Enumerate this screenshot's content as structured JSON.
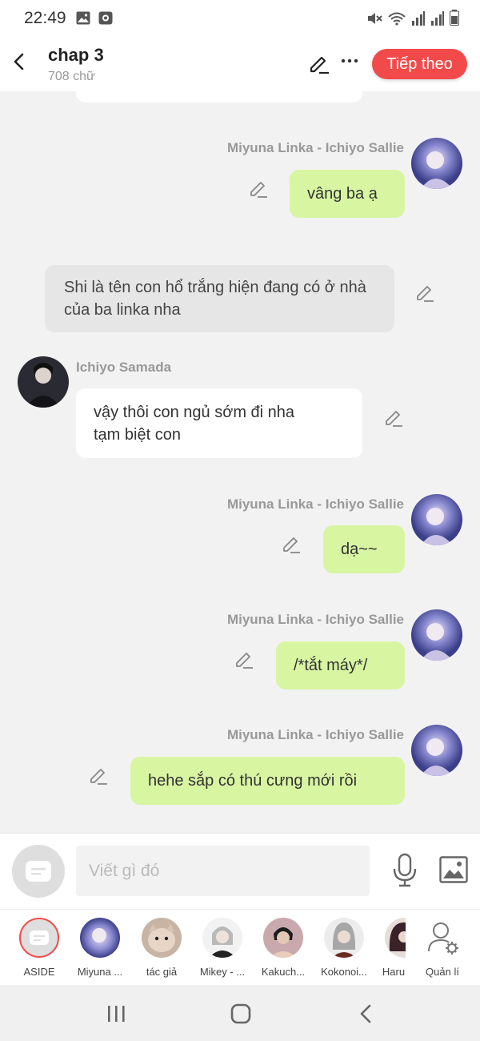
{
  "status_bar": {
    "time": "22:49"
  },
  "header": {
    "title": "chap 3",
    "subtitle": "708 chữ",
    "next_label": "Tiếp theo"
  },
  "chat": {
    "messages": [
      {
        "sender": "Miyuna Linka - Ichiyo Sallie",
        "text": "vâng ba ạ"
      },
      {
        "sender": "",
        "text_line1": "Shi là tên con hổ trắng hiện đang có ở nhà",
        "text_line2": "của ba linka nha"
      },
      {
        "sender": "Ichiyo Samada",
        "text_line1": "vậy thôi con ngủ sớm đi nha",
        "text_line2": "tạm biệt con"
      },
      {
        "sender": "Miyuna Linka - Ichiyo Sallie",
        "text": "dạ~~"
      },
      {
        "sender": "Miyuna Linka - Ichiyo Sallie",
        "text": "/*tắt máy*/"
      },
      {
        "sender": "Miyuna Linka - Ichiyo Sallie",
        "text": "hehe sắp có thú cưng mới rồi"
      }
    ]
  },
  "composer": {
    "placeholder": "Viết gì đó"
  },
  "characters": [
    {
      "label": "ASIDE"
    },
    {
      "label": "Miyuna ..."
    },
    {
      "label": "tác giả"
    },
    {
      "label": "Mikey - ..."
    },
    {
      "label": "Kakuch..."
    },
    {
      "label": "Kokonoi..."
    },
    {
      "label": "Haru"
    },
    {
      "label": "Quản lí"
    }
  ],
  "colors": {
    "accent": "#f24a4a",
    "my_bubble": "#d8f5a2",
    "other_bubble": "#ffffff",
    "narration_bubble": "#e6e6e6"
  }
}
